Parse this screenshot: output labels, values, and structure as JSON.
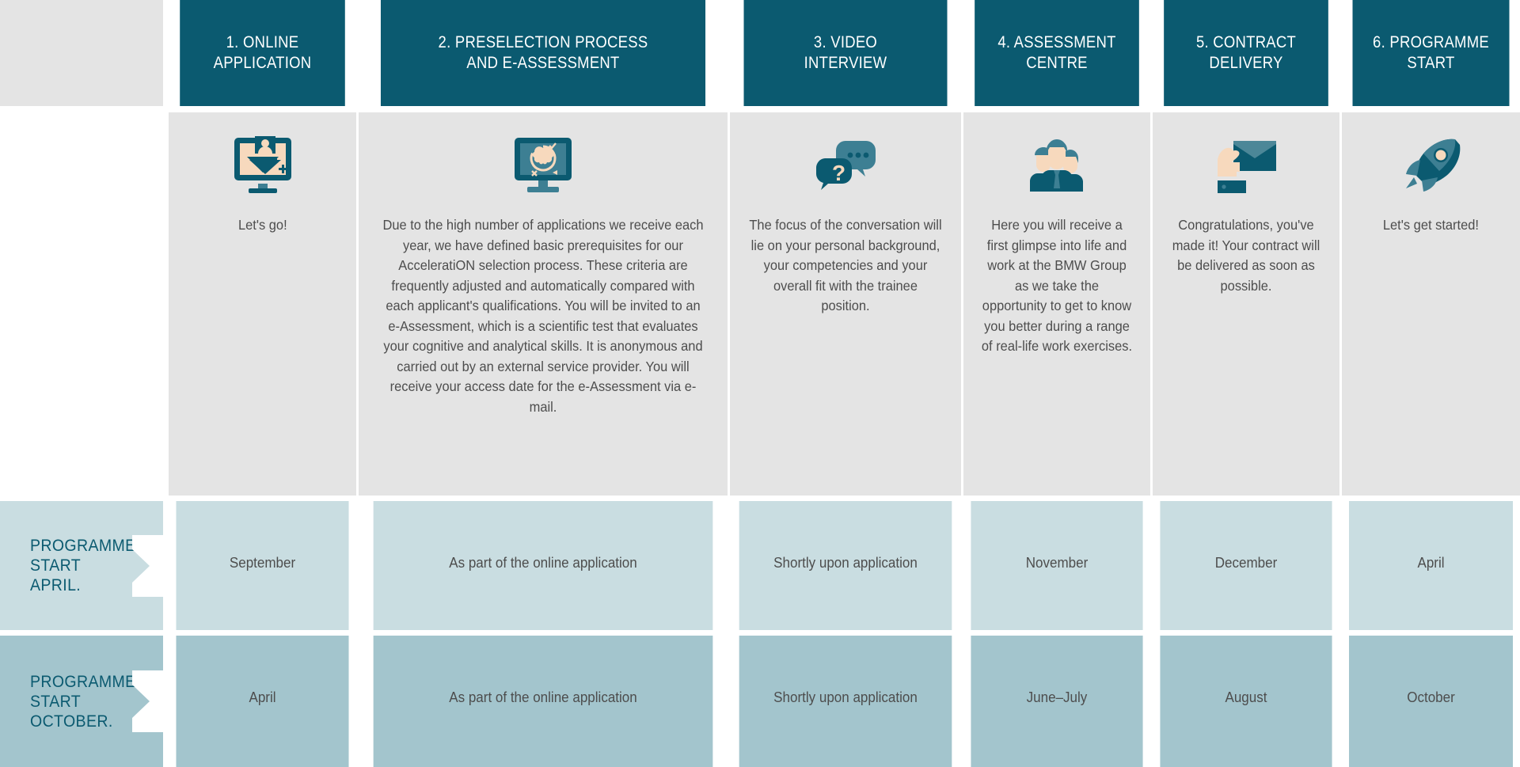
{
  "theme": {
    "teal": "#0b5a70",
    "teal_mid": "#3d7f93",
    "skin": "#f7d9bd",
    "header_bg": "#0b5a70",
    "header_text": "#ffffff",
    "body_bg": "#e4e4e4",
    "body_text": "#4d4d4d",
    "row1_bg": "#c9dde1",
    "row2_bg": "#a3c5cd",
    "side_text": "#0b5a70",
    "page_bg": "#ffffff"
  },
  "steps": [
    {
      "header": "1. ONLINE\nAPPLICATION",
      "icon": "monitor-person-download-icon",
      "description": "Let's go!"
    },
    {
      "header": "2. PRESELECTION PROCESS\nAND E-ASSESSMENT",
      "icon": "monitor-brain-assessment-icon",
      "description": "Due to the high number of applications we receive each year, we have defined basic prerequisites for our AcceleratiON selection process. These criteria are frequently adjusted and automatically compared with each applicant's qualifications. You will be invited to an e-Assessment, which is a scientific test that evaluates your cognitive and analytical skills. It is anonymous and carried out by an external service provider. You will receive your access date for the e-Assessment via e-mail."
    },
    {
      "header": "3.  VIDEO\nINTERVIEW",
      "icon": "speech-bubbles-question-icon",
      "description": "The focus of the conversation will lie on your personal background, your competencies and your overall fit with the trainee position."
    },
    {
      "header": "4. ASSESSMENT\nCENTRE",
      "icon": "people-group-icon",
      "description": "Here you will receive a first glimpse into life and work at the BMW Group as we take the opportunity to get to know you better during a range of real-life work exercises."
    },
    {
      "header": "5. CONTRACT\nDELIVERY",
      "icon": "hand-envelope-icon",
      "description": "Congratulations, you've made it! Your contract will be delivered as soon as possible."
    },
    {
      "header": "6. PROGRAMME\nSTART",
      "icon": "rocket-icon",
      "description": "Let's get started!"
    }
  ],
  "timeline": [
    {
      "label": "PROGRAMME\nSTART\nAPRIL.",
      "values": [
        "September",
        "As part of the online application",
        "Shortly upon application",
        "November",
        "December",
        "April"
      ]
    },
    {
      "label": "PROGRAMME\nSTART\nOCTOBER.",
      "values": [
        "April",
        "As part of the online application",
        "Shortly upon application",
        "June–July",
        "August",
        "October"
      ]
    }
  ]
}
